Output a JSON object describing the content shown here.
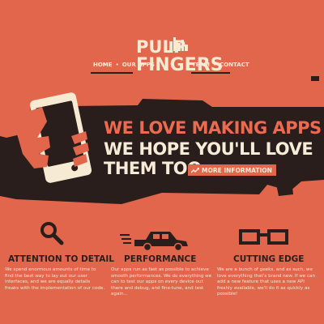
{
  "brand": {
    "line1": "PULP",
    "line2": "FINGERS",
    "icon": "city-skyline-icon"
  },
  "nav": {
    "left": [
      {
        "label": "Home",
        "active": true
      },
      {
        "label": "Our Apps",
        "active": false
      }
    ],
    "right": [
      {
        "label": "Team",
        "active": false
      },
      {
        "label": "Contact",
        "active": false
      }
    ],
    "separator": "•"
  },
  "hero": {
    "line1": "WE LOVE MAKING APPS",
    "line2": "WE HOPE YOU'LL LOVE",
    "line3": "THEM TOO",
    "button": {
      "label": "MORE INFORMATION",
      "icon": "trend-arrow-icon"
    },
    "illustration": "hand-holding-phone-icon"
  },
  "features": [
    {
      "icon": "magnifying-glass-icon",
      "title": "ATTENTION TO DETAIL",
      "text": "We spend enormous amounts of time to find the best way to lay out our user interfaces, and we are equally details freaks with the implementation of our code."
    },
    {
      "icon": "car-icon",
      "title": "PERFORMANCE",
      "text": "Our apps run as fast as possible to achieve smooth performances. We do everything we can to test our apps on every device out there and debug, and fine-tune, and test again..."
    },
    {
      "icon": "glasses-icon",
      "title": "CUTTING EDGE",
      "text": "We are a bunch of geeks, and as such, we love everything that's brand new. If we can add a new feature that uses a new API freshly available, we'll do it as quickly as possible!"
    }
  ],
  "colors": {
    "background": "#e2664c",
    "dark": "#2a1e1d",
    "cream": "#f7ecd7",
    "accent": "#ec6a4f"
  }
}
